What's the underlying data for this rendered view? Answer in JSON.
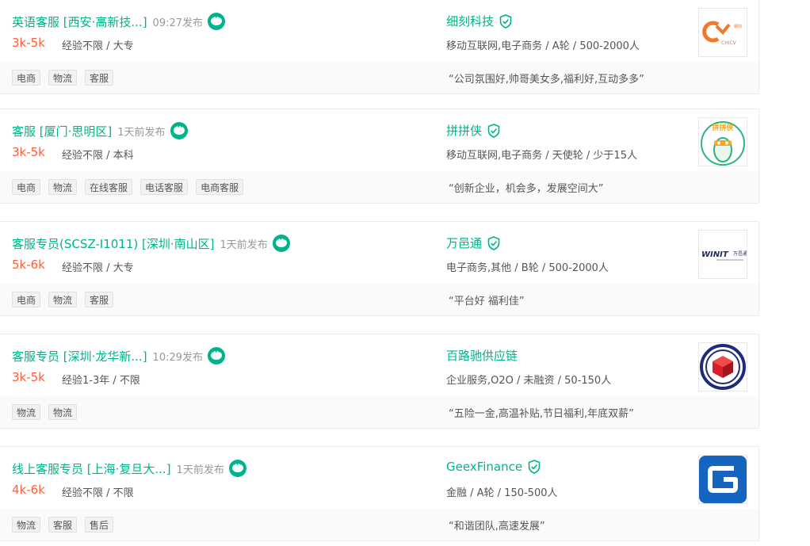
{
  "jobs": [
    {
      "title": "英语客服 [西安·高新技...]",
      "time": "09:27发布",
      "salary": "3k-5k",
      "requirements": "经验不限 / 大专",
      "tags": [
        "电商",
        "物流",
        "客服"
      ],
      "company": "细刻科技",
      "verified": true,
      "industry": "移动互联网,电子商务 / A轮 / 500-2000人",
      "slogan": "“公司氛围好,帅哥美女多,福利好,互动多多”",
      "logo": {
        "type": "chicv",
        "text": "CHICV",
        "sub": "細刻",
        "color": "#f07a2b"
      }
    },
    {
      "title": "客服 [厦门·思明区]",
      "time": "1天前发布",
      "salary": "3k-5k",
      "requirements": "经验不限 / 本科",
      "tags": [
        "电商",
        "物流",
        "在线客服",
        "电话客服",
        "电商客服"
      ],
      "company": "拼拼侠",
      "verified": true,
      "industry": "移动互联网,电子商务 / 天使轮 / 少于15人",
      "slogan": "“创新企业，机会多，发展空间大”",
      "logo": {
        "type": "pinpinxia",
        "text": "拼拼侠",
        "color": "#2db47a"
      }
    },
    {
      "title": "客服专员(SCSZ-I1011) [深圳·南山区]",
      "time": "1天前发布",
      "salary": "5k-6k",
      "requirements": "经验不限 / 大专",
      "tags": [
        "电商",
        "物流",
        "客服"
      ],
      "company": "万邑通",
      "verified": true,
      "industry": "电子商务,其他 / B轮 / 500-2000人",
      "slogan": "“平台好 福利佳”",
      "logo": {
        "type": "winit",
        "text": "WINIT",
        "sub": "万邑通",
        "color": "#1b2a6b"
      }
    },
    {
      "title": "客服专员 [深圳·龙华新...]",
      "time": "10:29发布",
      "salary": "3k-5k",
      "requirements": "经验1-3年 / 不限",
      "tags": [
        "物流",
        "物流"
      ],
      "company": "百路驰供应链",
      "verified": false,
      "industry": "企业服务,O2O / 未融资 / 50-150人",
      "slogan": "“五险一金,高温补贴,节日福利,年底双薪”",
      "logo": {
        "type": "cube",
        "color": "#1e2b7a",
        "accent": "#d7202a"
      }
    },
    {
      "title": "线上客服专员 [上海·复旦大...]",
      "time": "1天前发布",
      "salary": "4k-6k",
      "requirements": "经验不限 / 不限",
      "tags": [
        "物流",
        "客服",
        "售后"
      ],
      "company": "GeexFinance",
      "verified": true,
      "industry": "金融 / A轮 / 150-500人",
      "slogan": "“和谐团队,高速发展”",
      "logo": {
        "type": "geex",
        "text": "G",
        "color": "#1565c0"
      }
    }
  ]
}
